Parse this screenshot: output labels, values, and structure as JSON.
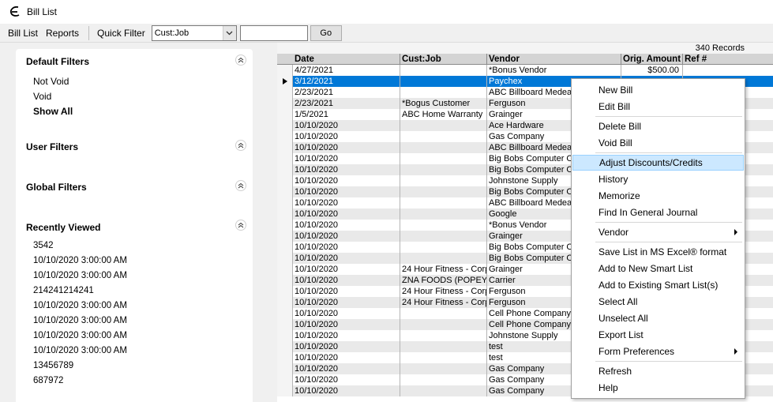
{
  "window": {
    "title": "Bill List"
  },
  "toolbar": {
    "menus": [
      "Bill List",
      "Reports"
    ],
    "quick_filter_label": "Quick Filter",
    "quick_filter_field": "Cust:Job",
    "quick_filter_value": "",
    "go_label": "Go"
  },
  "left": {
    "default_filters": {
      "title": "Default Filters",
      "items": [
        "Not Void",
        "Void",
        "Show All"
      ]
    },
    "user_filters": {
      "title": "User Filters"
    },
    "global_filters": {
      "title": "Global Filters"
    },
    "recently_viewed": {
      "title": "Recently Viewed",
      "items": [
        "3542",
        "10/10/2020 3:00:00 AM",
        "10/10/2020 3:00:00 AM",
        "214241214241",
        "10/10/2020 3:00:00 AM",
        "10/10/2020 3:00:00 AM",
        "10/10/2020 3:00:00 AM",
        "10/10/2020 3:00:00 AM",
        "13456789",
        "687972"
      ]
    }
  },
  "grid": {
    "records_label": "340 Records",
    "columns": [
      "Date",
      "Cust:Job",
      "Vendor",
      "Orig. Amount",
      "Ref #"
    ],
    "rows": [
      [
        "4/27/2021",
        "",
        "*Bonus Vendor",
        "$500.00",
        ""
      ],
      [
        "3/12/2021",
        "",
        "Paychex",
        "",
        ""
      ],
      [
        "2/23/2021",
        "",
        "ABC Billboard Medea",
        "",
        ""
      ],
      [
        "2/23/2021",
        "*Bogus Customer",
        "Ferguson",
        "",
        ""
      ],
      [
        "1/5/2021",
        "ABC Home Warranty",
        "Grainger",
        "",
        ""
      ],
      [
        "10/10/2020",
        "",
        "Ace Hardware",
        "",
        ""
      ],
      [
        "10/10/2020",
        "",
        "Gas Company",
        "",
        ""
      ],
      [
        "10/10/2020",
        "",
        "ABC Billboard Medea",
        "",
        ""
      ],
      [
        "10/10/2020",
        "",
        "Big Bobs Computer Ou",
        "",
        ""
      ],
      [
        "10/10/2020",
        "",
        "Big Bobs Computer Ou",
        "",
        ""
      ],
      [
        "10/10/2020",
        "",
        "Johnstone Supply",
        "",
        ""
      ],
      [
        "10/10/2020",
        "",
        "Big Bobs Computer Ou",
        "",
        ""
      ],
      [
        "10/10/2020",
        "",
        "ABC Billboard Medea",
        "",
        ""
      ],
      [
        "10/10/2020",
        "",
        "Google",
        "",
        ""
      ],
      [
        "10/10/2020",
        "",
        "*Bonus Vendor",
        "",
        ""
      ],
      [
        "10/10/2020",
        "",
        "Grainger",
        "",
        ""
      ],
      [
        "10/10/2020",
        "",
        "Big Bobs Computer Ou",
        "",
        ""
      ],
      [
        "10/10/2020",
        "",
        "Big Bobs Computer Ou",
        "",
        ""
      ],
      [
        "10/10/2020",
        "24 Hour Fitness - Corp",
        "Grainger",
        "",
        ""
      ],
      [
        "10/10/2020",
        "ZNA FOODS (POPEYE'",
        "Carrier",
        "",
        ""
      ],
      [
        "10/10/2020",
        "24 Hour Fitness - Corp",
        "Ferguson",
        "",
        ""
      ],
      [
        "10/10/2020",
        "24 Hour Fitness - Corp",
        "Ferguson",
        "",
        ""
      ],
      [
        "10/10/2020",
        "",
        "Cell Phone Company",
        "",
        ""
      ],
      [
        "10/10/2020",
        "",
        "Cell Phone Company",
        "",
        ""
      ],
      [
        "10/10/2020",
        "",
        "Johnstone Supply",
        "",
        ""
      ],
      [
        "10/10/2020",
        "",
        "test",
        "",
        ""
      ],
      [
        "10/10/2020",
        "",
        "test",
        "",
        ""
      ],
      [
        "10/10/2020",
        "",
        "Gas Company",
        "",
        ""
      ],
      [
        "10/10/2020",
        "",
        "Gas Company",
        "",
        ""
      ],
      [
        "10/10/2020",
        "",
        "Gas Company",
        "",
        ""
      ]
    ]
  },
  "context_menu": {
    "items": [
      {
        "label": "New Bill",
        "sep_after": false
      },
      {
        "label": "Edit Bill",
        "sep_after": true
      },
      {
        "label": "Delete Bill",
        "sep_after": false
      },
      {
        "label": "Void Bill",
        "sep_after": true
      },
      {
        "label": "Adjust Discounts/Credits",
        "sep_after": false,
        "highlighted": true
      },
      {
        "label": "History",
        "sep_after": false
      },
      {
        "label": "Memorize",
        "sep_after": false
      },
      {
        "label": "Find In General Journal",
        "sep_after": true
      },
      {
        "label": "Vendor",
        "sep_after": true,
        "submenu": true
      },
      {
        "label": "Save List in MS Excel® format",
        "sep_after": false
      },
      {
        "label": "Add to New Smart List",
        "sep_after": false
      },
      {
        "label": "Add to Existing Smart List(s)",
        "sep_after": false
      },
      {
        "label": "Select All",
        "sep_after": false
      },
      {
        "label": "Unselect All",
        "sep_after": false
      },
      {
        "label": "Export List",
        "sep_after": false
      },
      {
        "label": "Form Preferences",
        "sep_after": true,
        "submenu": true
      },
      {
        "label": "Refresh",
        "sep_after": false
      },
      {
        "label": "Help",
        "sep_after": false
      }
    ]
  },
  "colors": {
    "selection": "#0078d7",
    "menu_highlight": "#cce8ff"
  }
}
